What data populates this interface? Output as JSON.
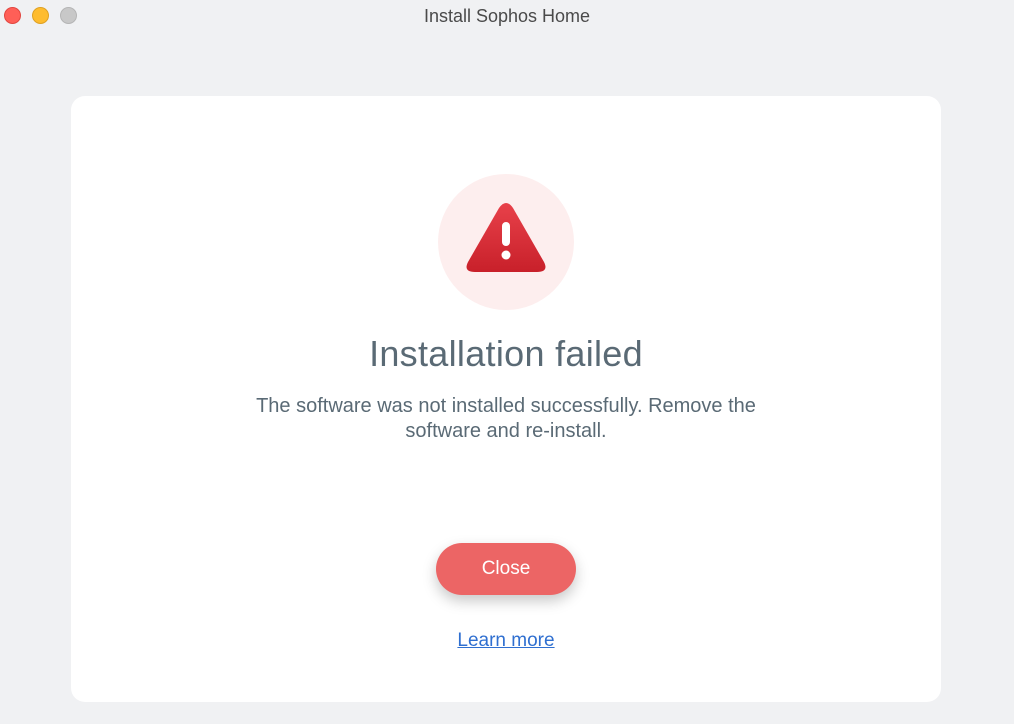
{
  "window": {
    "title": "Install Sophos Home"
  },
  "dialog": {
    "icon": "warning-triangle-icon",
    "heading": "Installation failed",
    "message_line1": "The software was not installed successfully. Remove the",
    "message_line2": "software and re-install.",
    "close_label": "Close",
    "learn_more_label": "Learn more"
  },
  "colors": {
    "accent": "#ec6565",
    "warning": "#d9252f",
    "link": "#2f6fd0",
    "text": "#5a6a75"
  }
}
